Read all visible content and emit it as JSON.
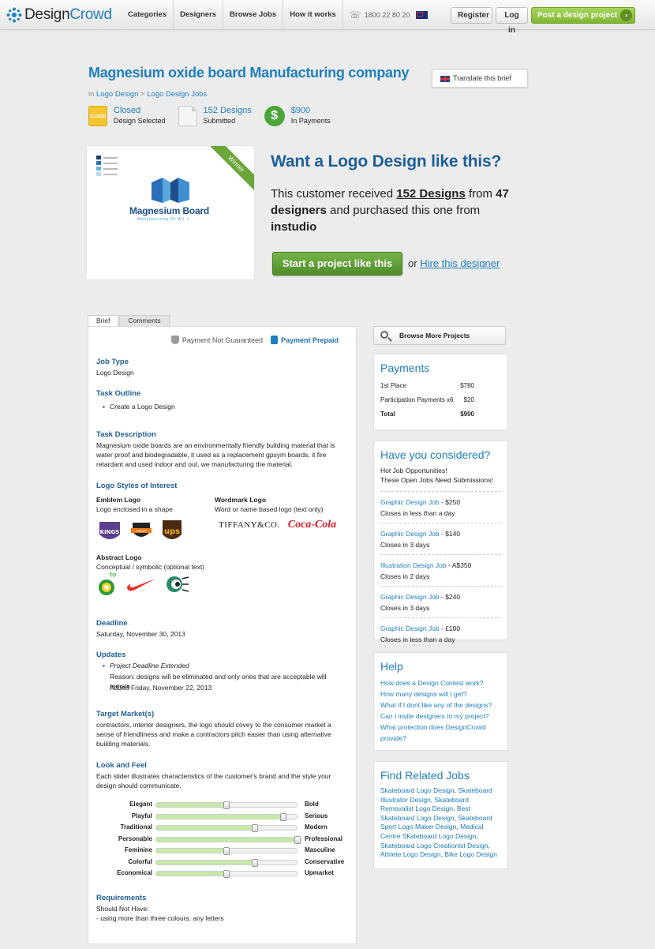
{
  "nav": {
    "brand_design": "Design",
    "brand_crowd": "Crowd",
    "items": [
      "Categories",
      "Designers",
      "Browse Jobs",
      "How it works"
    ],
    "phone": "1800 22 80 20",
    "register": "Register",
    "login": "Log in",
    "post": "Post a design project"
  },
  "header": {
    "title": "Magnesium oxide board Manufacturing company",
    "translate": "Translate this brief",
    "breadcrumb_in": "in",
    "breadcrumb_1": "Logo Design",
    "breadcrumb_sep": ">",
    "breadcrumb_2": "Logo Design Jobs",
    "stats": [
      {
        "top": "Closed",
        "bottom": "Design Selected",
        "badge": "CLOSED"
      },
      {
        "top": "152 Designs",
        "bottom": "Submitted"
      },
      {
        "top": "$900",
        "bottom": "In Payments",
        "icon": "$"
      }
    ]
  },
  "design": {
    "winner": "Winner",
    "name": "Magnesium Board",
    "sub": "Manufacturing Co W.L.L"
  },
  "cta": {
    "title": "Want a Logo Design like this?",
    "l1": "This customer received",
    "designs": "152 Designs",
    "l2": "from",
    "designers": "47 designers",
    "l3": "and purchased this one from",
    "designer": "instudio",
    "start": "Start a project like this",
    "or": "or",
    "hire": "Hire this designer"
  },
  "brief": {
    "tab_brief": "Brief",
    "tab_comments": "Comments",
    "not_guaranteed": "Payment Not Guaranteed",
    "prepaid": "Payment Prepaid",
    "job_type_h": "Job Type",
    "job_type": "Logo Design",
    "outline_h": "Task Outline",
    "outline": "Create a Logo Design",
    "desc_h": "Task Description",
    "desc": "Magnesium oxide boards are an environmentally friendly building material that is water proof and biodegradable, it used as a replacement gpsym boards, it fire retardant and used indoor and out, we manufacturing the material.",
    "styles_h": "Logo Styles of Interest",
    "emblem_h": "Emblem Logo",
    "emblem_t": "Logo enclosed in a shape",
    "wordmark_h": "Wordmark Logo",
    "wordmark_t": "Word or name based logo (text only)",
    "abstract_h": "Abstract Logo",
    "abstract_t": "Conceptual / symbolic (optional text)",
    "logo_tiffany": "TIFFANY&CO.",
    "logo_coke": "Coca-Cola",
    "logo_ups": "ups",
    "logo_bp": "bp",
    "deadline_h": "Deadline",
    "deadline": "Saturday, November 30, 2013",
    "updates_h": "Updates",
    "update_title": "Project Deadline Extended",
    "update_reason": "Reason: designs will be eliminated and only ones that are acceptable will remain",
    "update_added": "Added Friday, November 22, 2013",
    "target_h": "Target Market(s)",
    "target": "contractors, interior designers, the logo should covey to the consumer market a sense of friendliness and make a contractors pitch easier than using alternative building materials.",
    "look_h": "Look and Feel",
    "look_t": "Each slider illustrates characteristics of the customer's brand and the style your design should communicate.",
    "sliders": [
      {
        "left": "Elegant",
        "right": "Bold",
        "value": 0.5
      },
      {
        "left": "Playful",
        "right": "Serious",
        "value": 0.9
      },
      {
        "left": "Traditional",
        "right": "Modern",
        "value": 0.7
      },
      {
        "left": "Personable",
        "right": "Professional",
        "value": 1.0
      },
      {
        "left": "Feminine",
        "right": "Masculine",
        "value": 0.5
      },
      {
        "left": "Colorful",
        "right": "Conservative",
        "value": 0.7
      },
      {
        "left": "Economical",
        "right": "Upmarket",
        "value": 0.5
      }
    ],
    "req_h": "Requirements",
    "req_1": "Should Not Have:",
    "req_2": "- using more than three colours, any letters"
  },
  "sidebar": {
    "browse": "Browse More Projects",
    "payments_h": "Payments",
    "payments": [
      {
        "label": "1st Place",
        "amount": "$780"
      },
      {
        "label": "Participation Payments x6",
        "amount": "$20"
      },
      {
        "label": "Total",
        "amount": "$900"
      }
    ],
    "considered_h": "Have you considered?",
    "considered_1": "Hot Job Opportunities!",
    "considered_2": "These Open Jobs Need Submissions!",
    "jobs": [
      {
        "title": "Graphic Design Job",
        "price": " - $250",
        "closes": "Closes in less than a day"
      },
      {
        "title": "Graphic Design Job",
        "price": " - $140",
        "closes": "Closes in 3 days"
      },
      {
        "title": "Illustration Design Job",
        "price": " - A$350",
        "closes": "Closes in 2 days"
      },
      {
        "title": "Graphic Design Job",
        "price": " - $240",
        "closes": "Closes in 3 days"
      },
      {
        "title": "Graphic Design Job",
        "price": " - £100",
        "closes": "Closes in less than a day"
      }
    ],
    "help_h": "Help",
    "help": [
      "How does a Design Contest work?",
      "How many designs will I get?",
      "What if I dont like any of the designs?",
      "Can I invite designers to my project?",
      "What protection does DesignCrowd provide?"
    ],
    "related_h": "Find Related Jobs",
    "related": [
      "Skateboard Logo Design",
      "Skateboard Illustrator Design",
      "Skateboard Removalist Logo Design",
      "Best Skateboard Logo Design",
      "Skateboard Sport Logo Maker Design",
      "Medical Centre Skateboard Logo Design",
      "Skateboard Logo Creationist Design",
      "Athlete Logo Design",
      "Bike Logo Design"
    ]
  },
  "colors": {
    "brand_blue": "#1f7fc1",
    "heading_blue": "#1f5f9a",
    "cta_green": "#5a9a33",
    "post_green": "#8cc443"
  }
}
